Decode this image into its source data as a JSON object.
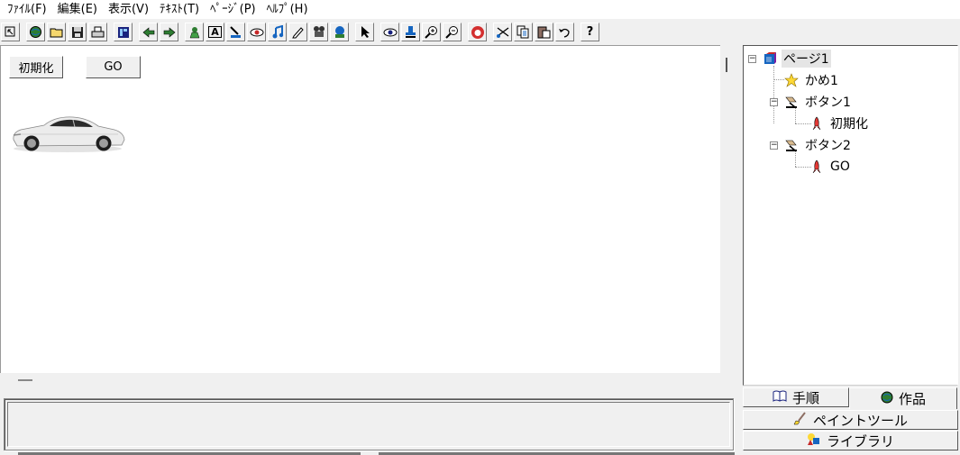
{
  "menu": [
    "ﾌｧｲﾙ(F)",
    "編集(E)",
    "表示(V)",
    "ﾃｷｽﾄ(T)",
    "ﾍﾟｰｼﾞ(P)",
    "ﾍﾙﾌﾟ(H)"
  ],
  "toolbar": {
    "icons": [
      "cursor-small-icon",
      "globe-icon",
      "open-folder-icon",
      "save-icon",
      "print-icon",
      "layout-icon",
      "back-arrow-icon",
      "forward-arrow-icon",
      "character-icon",
      "text-box-icon",
      "button-tool-icon",
      "eye-shape-icon",
      "music-note-icon",
      "pen-icon",
      "movie-icon",
      "globe-tool-icon",
      "pointer-icon",
      "view-icon",
      "stamp-icon",
      "zoom-in-icon",
      "zoom-out-icon",
      "stop-hand-icon",
      "cut-icon",
      "copy-icon",
      "paste-icon",
      "undo-icon",
      "help-icon"
    ],
    "help_label": "?",
    "text_tool_label": "A"
  },
  "canvas": {
    "init_button": "初期化",
    "go_button": "GO"
  },
  "tree": {
    "nodes": [
      {
        "label": "ページ1",
        "icon": "page-icon"
      },
      {
        "label": "かめ1",
        "icon": "star-character-icon"
      },
      {
        "label": "ボタン1",
        "icon": "button-node-icon"
      },
      {
        "label": "初期化",
        "icon": "rocket-script-icon"
      },
      {
        "label": "ボタン2",
        "icon": "button-node-icon"
      },
      {
        "label": "GO",
        "icon": "rocket-script-icon"
      }
    ]
  },
  "tabs": {
    "procedure": "手順",
    "work": "作品",
    "paint_tool": "ペイントツール",
    "library": "ライブラリ"
  },
  "colors": {
    "background": "#f0f0f0",
    "canvas": "#ffffff",
    "car_body": "#e9e9e9"
  }
}
